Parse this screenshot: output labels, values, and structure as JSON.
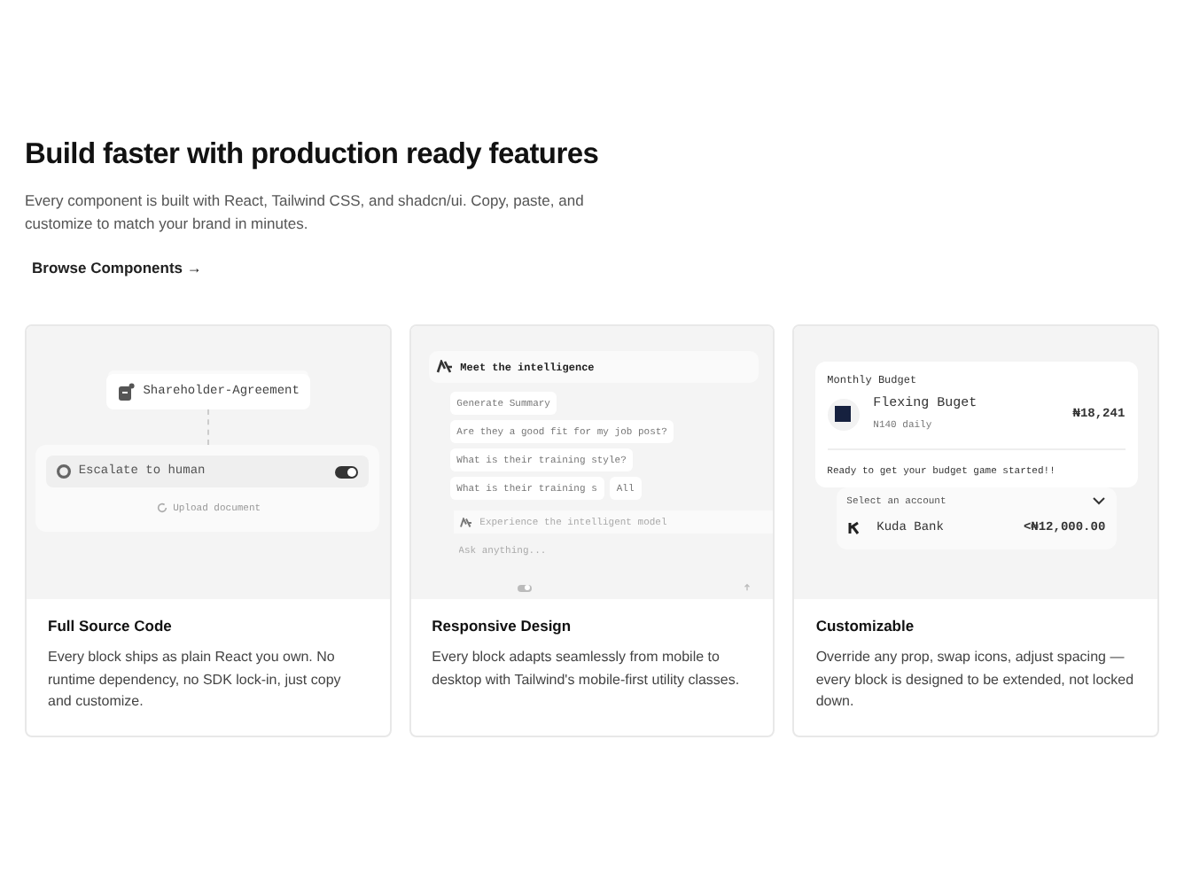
{
  "heading": "Build faster with production ready features",
  "intro": "Every component is built with React, Tailwind CSS, and shadcn/ui. Copy, paste, and customize to match your brand in minutes.",
  "link": {
    "label": "Browse Components",
    "arrow": "→"
  },
  "cards": [
    {
      "kind": "workflow",
      "title": "Full Source Code",
      "body": "Every block ships as plain React you own. No runtime dependency, no SDK lock-in, just copy and customize.",
      "preview": {
        "node": "Shareholder-Agreement",
        "step": "Escalate to human",
        "toggle_on": true,
        "action": "Upload document"
      }
    },
    {
      "kind": "assistant",
      "title": "Responsive Design",
      "body": "Every block adapts seamlessly from mobile to desktop with Tailwind's mobile-first utility classes.",
      "preview": {
        "header": "Meet the intelligence",
        "chips": [
          "Generate Summary",
          "Are they a good fit for my job post?",
          "What is their training style?",
          "What is their training s",
          "All"
        ],
        "prompt": "Experience the intelligent model",
        "placeholder": "Ask anything...",
        "toggle_on": true
      }
    },
    {
      "kind": "budget",
      "title": "Customizable",
      "body": "Override any prop, swap icons, adjust spacing — every block is designed to be extended, not locked down.",
      "preview": {
        "label": "Monthly Budget",
        "name": "Flexing Buget",
        "rate": "N140 daily",
        "amount": "₦18,241",
        "message": "Ready to get your budget game started!!",
        "select": "Select an account",
        "bank": "Kuda Bank",
        "balance": "<₦12,000.00"
      }
    }
  ]
}
